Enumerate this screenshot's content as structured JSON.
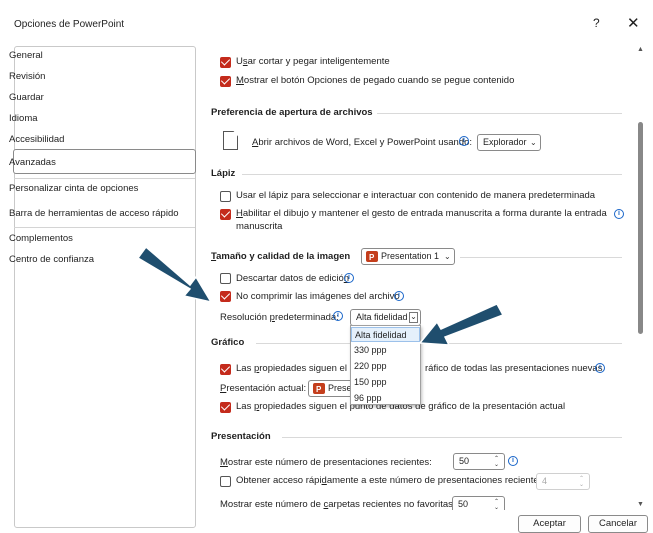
{
  "window": {
    "title": "Opciones de PowerPoint",
    "help": "?",
    "close": "✕"
  },
  "sidebar": {
    "items": [
      {
        "label": "General"
      },
      {
        "label": "Revisión"
      },
      {
        "label": "Guardar"
      },
      {
        "label": "Idioma"
      },
      {
        "label": "Accesibilidad"
      },
      {
        "label": "Avanzadas",
        "selected": true
      },
      {
        "label": "Personalizar cinta de opciones"
      },
      {
        "label": "Barra de herramientas de acceso rápido"
      },
      {
        "label": "Complementos"
      },
      {
        "label": "Centro de confianza"
      }
    ]
  },
  "main": {
    "edit": {
      "smart_cut_pre": "U",
      "smart_cut_key": "s",
      "smart_cut_post": "ar cortar y pegar inteligentemente",
      "paste_btn_key": "M",
      "paste_btn_post": "ostrar el botón Opciones de pegado cuando se pegue contenido"
    },
    "open_prefs": {
      "header": "Preferencia de apertura de archivos",
      "label_key": "A",
      "label_post": "brir archivos de Word, Excel y PowerPoint usando:",
      "value": "Explorador"
    },
    "pen": {
      "header": "Lápiz",
      "use_pen": "Usar el lápiz para seleccionar e interactuar con contenido de manera predeterminada",
      "ink_key": "H",
      "ink_line1": "abilitar el dibujo y mantener el gesto de entrada manuscrita a forma durante la entrada",
      "ink_line2": "manuscrita"
    },
    "image": {
      "header_pre": "T",
      "header_post": "amaño y calidad de la imagen",
      "presentation": "Presentation 1",
      "discard_pre": "Descartar datos de edició",
      "discard_key": "n",
      "no_compress": "No comprimir las imágenes del archivo",
      "resolution_pre": "Resolución ",
      "resolution_key": "p",
      "resolution_post": "redeterminada:",
      "resolution_value": "Alta fidelidad",
      "resolution_options": [
        "Alta fidelidad",
        "330 ppp",
        "220 ppp",
        "150 ppp",
        "96 ppp"
      ]
    },
    "chart": {
      "header": "Gráfico",
      "props_new_pre": "Las ",
      "props_new_key": "p",
      "props_new_a": "ropiedades siguen el pu",
      "props_new_b": "ráfico de todas las presentaciones nuevas",
      "current_key": "P",
      "current_post": "resentación actual:",
      "current_value": "Presen",
      "props_cur_pre": "Las ",
      "props_cur_key": "p",
      "props_cur_a": "ropiedades siguen el punto de datos de gráfico de la presentación actual"
    },
    "display": {
      "header": "Presentación",
      "recent_key": "M",
      "recent_post": "ostrar este número de presentaciones recientes:",
      "recent_value": "50",
      "quick_pre": "Obtener acceso rápi",
      "quick_key": "d",
      "quick_post": "amente a este número de presentaciones recientes:",
      "quick_value": "4",
      "folders_pre": "Mostrar este número de ",
      "folders_key": "c",
      "folders_post": "arpetas recientes no favoritas:",
      "folders_value": "50"
    }
  },
  "footer": {
    "ok": "Aceptar",
    "cancel": "Cancelar"
  },
  "colors": {
    "accent": "#c42b1c",
    "info": "#1a66c9",
    "arrow": "#1f4e6e"
  }
}
